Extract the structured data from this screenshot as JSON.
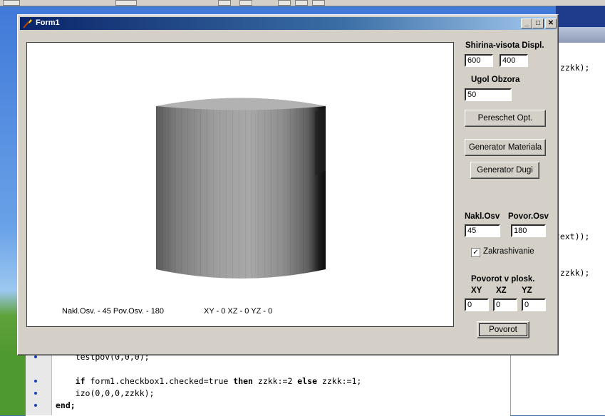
{
  "window": {
    "title": "Form1",
    "controls": {
      "minimize": "_",
      "maximize": "□",
      "close": "✕"
    }
  },
  "display": {
    "header": "Shirina-visota Displ.",
    "width_value": "600",
    "height_value": "400"
  },
  "view_angle": {
    "label": "Ugol Obzora",
    "value": "50"
  },
  "buttons": {
    "recalc": "Pereschet Opt.",
    "material": "Generator Materiala",
    "arcs": "Generator Dugi",
    "rotate": "Povorot"
  },
  "lighting": {
    "tilt_label": "Nakl.Osv",
    "turn_label": "Povor.Osv",
    "tilt_value": "45",
    "turn_value": "180",
    "shading_label": "Zakrashivanie",
    "shading_checked": true,
    "shading_mark": "✓"
  },
  "plane_rotation": {
    "header": "Povorot v plosk.",
    "xy_label": "XY",
    "xz_label": "XZ",
    "yz_label": "YZ",
    "xy": "0",
    "xz": "0",
    "yz": "0"
  },
  "canvas_status": {
    "light": "Nakl.Osv. - 45  Pov.Osv. - 180",
    "planes": "XY - 0  XZ - 0  YZ - 0"
  },
  "code_editor": {
    "right_lines": [
      ",zzkk);",
      "text));",
      ",zzkk);"
    ],
    "bottom_lines": [
      "    testpov(0,0,0);",
      "",
      "    if form1.checkbox1.checked=true then zzkk:=2 else zzkk:=1;",
      "    izo(0,0,0,zzkk);",
      "end;"
    ]
  },
  "colors": {
    "title_start": "#0a246a",
    "title_end": "#a6caf0",
    "face": "#d4d0c8"
  }
}
